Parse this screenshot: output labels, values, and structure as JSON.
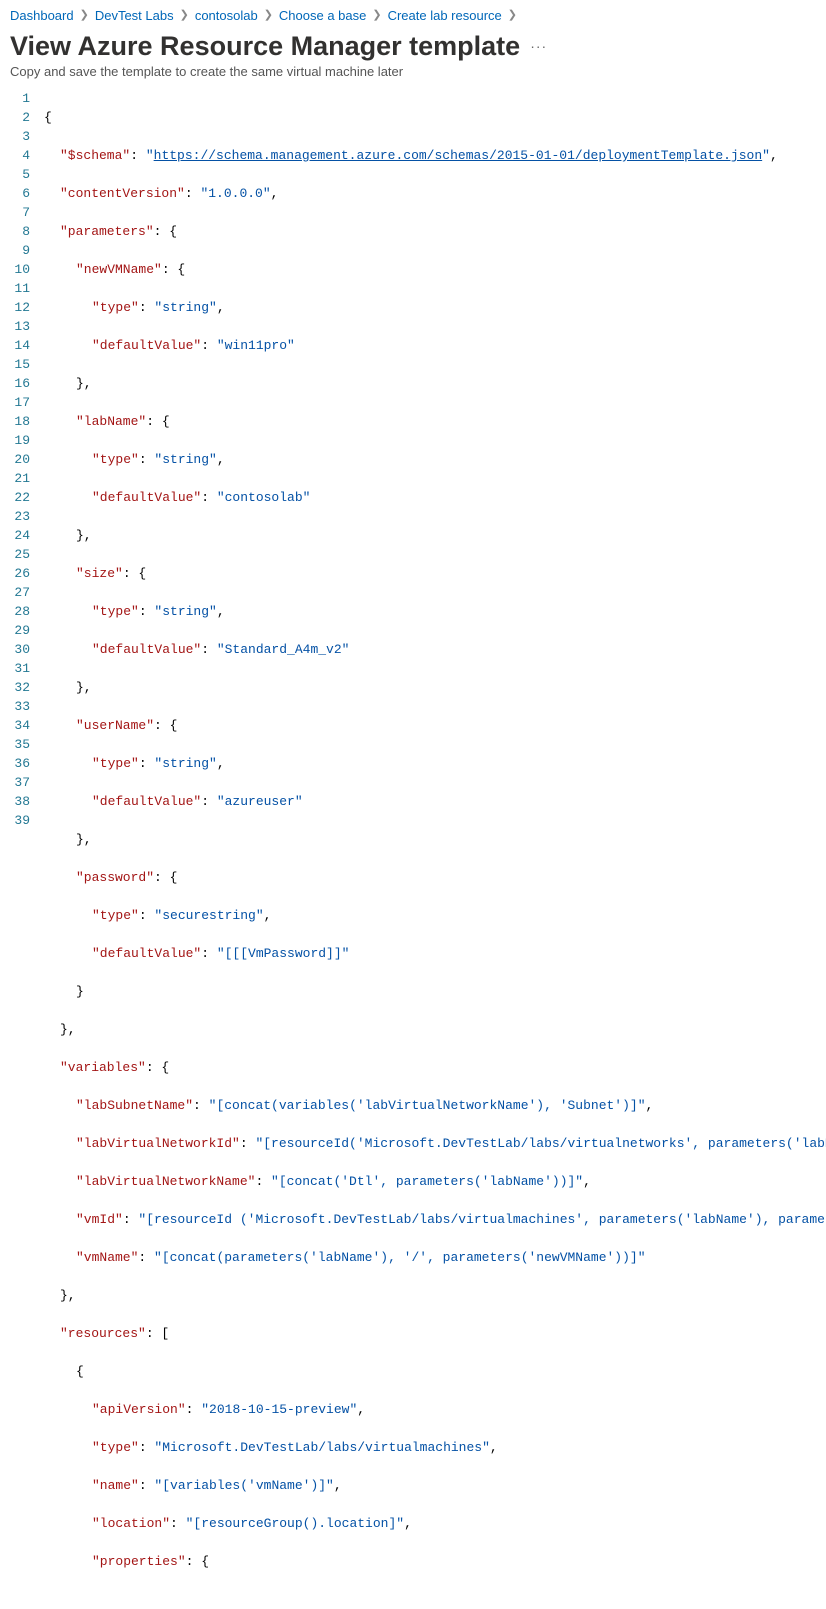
{
  "breadcrumb": {
    "items": [
      "Dashboard",
      "DevTest Labs",
      "contosolab",
      "Choose a base",
      "Create lab resource"
    ]
  },
  "header": {
    "title": "View Azure Resource Manager template",
    "subtitle": "Copy and save the template to create the same virtual machine later"
  },
  "code": {
    "schema_key": "\"$schema\"",
    "schema_url": "https://schema.management.azure.com/schemas/2015-01-01/deploymentTemplate.json",
    "contentVersion_key": "\"contentVersion\"",
    "contentVersion_val": "\"1.0.0.0\"",
    "parameters_key": "\"parameters\"",
    "newVMName_key": "\"newVMName\"",
    "type_key": "\"type\"",
    "string_val": "\"string\"",
    "defaultValue_key": "\"defaultValue\"",
    "newVMName_default": "\"win11pro\"",
    "labName_key": "\"labName\"",
    "labName_default": "\"contosolab\"",
    "size_key": "\"size\"",
    "size_default": "\"Standard_A4m_v2\"",
    "userName_key": "\"userName\"",
    "userName_default": "\"azureuser\"",
    "password_key": "\"password\"",
    "securestring_val": "\"securestring\"",
    "password_default": "\"[[[VmPassword]]\"",
    "variables_key": "\"variables\"",
    "labSubnetName_key": "\"labSubnetName\"",
    "labSubnetName_val": "\"[concat(variables('labVirtualNetworkName'), 'Subnet')]\"",
    "labVirtualNetworkId_key": "\"labVirtualNetworkId\"",
    "labVirtualNetworkId_val": "\"[resourceId('Microsoft.DevTestLab/labs/virtualnetworks', parameters('labN",
    "labVirtualNetworkName_key": "\"labVirtualNetworkName\"",
    "labVirtualNetworkName_val": "\"[concat('Dtl', parameters('labName'))]\"",
    "vmId_key": "\"vmId\"",
    "vmId_val": "\"[resourceId ('Microsoft.DevTestLab/labs/virtualmachines', parameters('labName'), paramet",
    "vmName_key": "\"vmName\"",
    "vmName_val": "\"[concat(parameters('labName'), '/', parameters('newVMName'))]\"",
    "resources_key": "\"resources\"",
    "apiVersion_key": "\"apiVersion\"",
    "apiVersion_val": "\"2018-10-15-preview\"",
    "res_type_key": "\"type\"",
    "res_type_val": "\"Microsoft.DevTestLab/labs/virtualmachines\"",
    "name_key": "\"name\"",
    "name_val": "\"[variables('vmName')]\"",
    "location_key": "\"location\"",
    "location_val": "\"[resourceGroup().location]\"",
    "properties_key": "\"properties\"",
    "line_count": 39
  }
}
